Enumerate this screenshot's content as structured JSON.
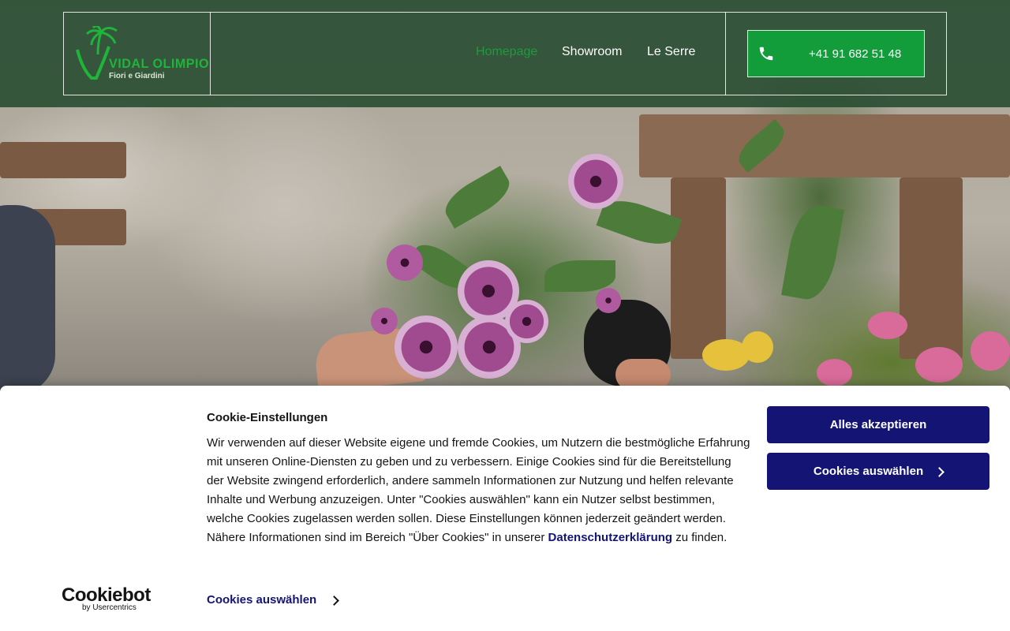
{
  "header": {
    "logo": {
      "name": "VIDAL OLIMPIO",
      "tagline": "Fiori e Giardini"
    },
    "nav": [
      {
        "label": "Homepage",
        "active": true
      },
      {
        "label": "Showroom",
        "active": false
      },
      {
        "label": "Le Serre",
        "active": false
      }
    ],
    "phone": {
      "icon": "phone-icon",
      "number": "+41 91 682 51 48"
    }
  },
  "cookie_banner": {
    "title": "Cookie-Einstellungen",
    "body_text": "Wir verwenden auf dieser Website eigene und fremde Cookies, um Nutzern die bestmögliche Erfahrung mit unseren Online-Diensten zu geben und zu verbessern. Einige Cookies sind für die Bereitstellung der Website zwingend erforderlich, andere sammeln Informationen zur Nutzung und helfen relevante Inhalte und Werbung anzuzeigen. Unter \"Cookies auswählen\" kann ein Nutzer selbst bestimmen, welche Cookies zugelassen werden sollen. Diese Einstellungen können jederzeit geändert werden. Nähere Informationen sind im Bereich \"Über Cookies\" in unserer",
    "privacy_link": "Datenschutzerklärung",
    "body_suffix": " zu finden.",
    "accept_all_label": "Alles akzeptieren",
    "select_cookies_label": "Cookies auswählen",
    "footer_select_label": "Cookies auswählen",
    "brand": {
      "name": "Cookiebot",
      "by": "by Usercentrics"
    }
  },
  "colors": {
    "header_bg": "#22482c",
    "brand_green": "#129c3a",
    "active_nav": "#1f9a3e",
    "cookie_button": "#141475"
  }
}
